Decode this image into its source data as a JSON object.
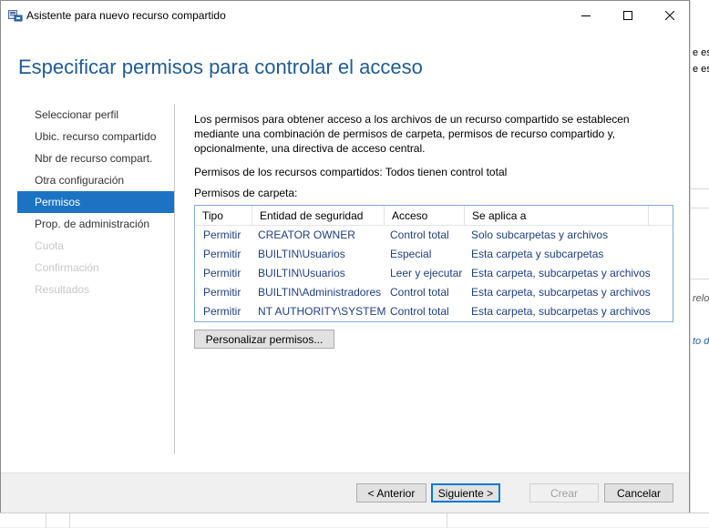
{
  "window": {
    "title": "Asistente para nuevo recurso compartido",
    "heading": "Especificar permisos para controlar el acceso"
  },
  "nav": {
    "items": [
      {
        "label": "Seleccionar perfil",
        "state": "normal"
      },
      {
        "label": "Ubic. recurso compartido",
        "state": "normal"
      },
      {
        "label": "Nbr de recurso compart.",
        "state": "normal"
      },
      {
        "label": "Otra configuración",
        "state": "normal"
      },
      {
        "label": "Permisos",
        "state": "active"
      },
      {
        "label": "Prop. de administración",
        "state": "normal"
      },
      {
        "label": "Cuota",
        "state": "disabled"
      },
      {
        "label": "Confirmación",
        "state": "disabled"
      },
      {
        "label": "Resultados",
        "state": "disabled"
      }
    ]
  },
  "content": {
    "description": "Los permisos para obtener acceso a los archivos de un recurso compartido se establecen mediante una combinación de permisos de carpeta, permisos de recurso compartido y, opcionalmente, una directiva de acceso central.",
    "share_permissions": "Permisos de los recursos compartidos: Todos tienen control total",
    "folder_permissions_label": "Permisos de carpeta:"
  },
  "table": {
    "columns": [
      "Tipo",
      "Entidad de seguridad",
      "Acceso",
      "Se aplica a"
    ],
    "rows": [
      [
        "Permitir",
        "CREATOR OWNER",
        "Control total",
        "Solo subcarpetas y archivos"
      ],
      [
        "Permitir",
        "BUILTIN\\Usuarios",
        "Especial",
        "Esta carpeta y subcarpetas"
      ],
      [
        "Permitir",
        "BUILTIN\\Usuarios",
        "Leer y ejecutar",
        "Esta carpeta, subcarpetas y archivos"
      ],
      [
        "Permitir",
        "BUILTIN\\Administradores",
        "Control total",
        "Esta carpeta, subcarpetas y archivos"
      ],
      [
        "Permitir",
        "NT AUTHORITY\\SYSTEM",
        "Control total",
        "Esta carpeta, subcarpetas y archivos"
      ]
    ]
  },
  "buttons": {
    "customize": "Personalizar permisos...",
    "back": "< Anterior",
    "next": "Siguiente >",
    "create": "Crear",
    "cancel": "Cancelar"
  },
  "background": {
    "right_snippets": [
      "e esp",
      "e esp",
      "relo",
      "to de"
    ]
  },
  "colors": {
    "accent": "#1c73c4",
    "heading": "#1e5c97",
    "table_text": "#1f3f82"
  }
}
